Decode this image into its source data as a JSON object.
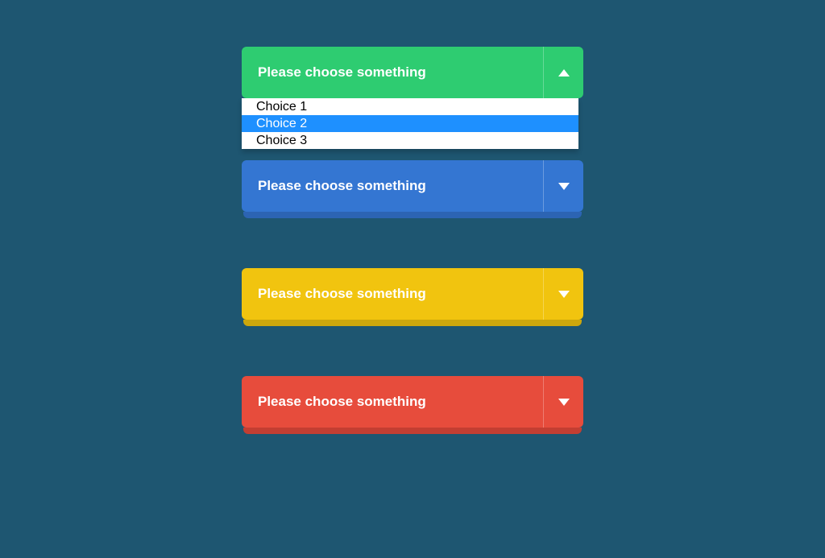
{
  "selects": {
    "green": {
      "label": "Please choose something",
      "open": true,
      "options": [
        {
          "label": "Choice 1",
          "highlighted": false
        },
        {
          "label": "Choice 2",
          "highlighted": true
        },
        {
          "label": "Choice 3",
          "highlighted": false
        }
      ]
    },
    "blue": {
      "label": "Please choose something",
      "open": false
    },
    "yellow": {
      "label": "Please choose something",
      "open": false
    },
    "red": {
      "label": "Please choose something",
      "open": false
    }
  },
  "colors": {
    "background": "#1e5671",
    "green": "#2ecc71",
    "blue": "#3476d2",
    "yellow": "#f1c40f",
    "red": "#e74c3c",
    "highlight": "#1e90ff"
  }
}
